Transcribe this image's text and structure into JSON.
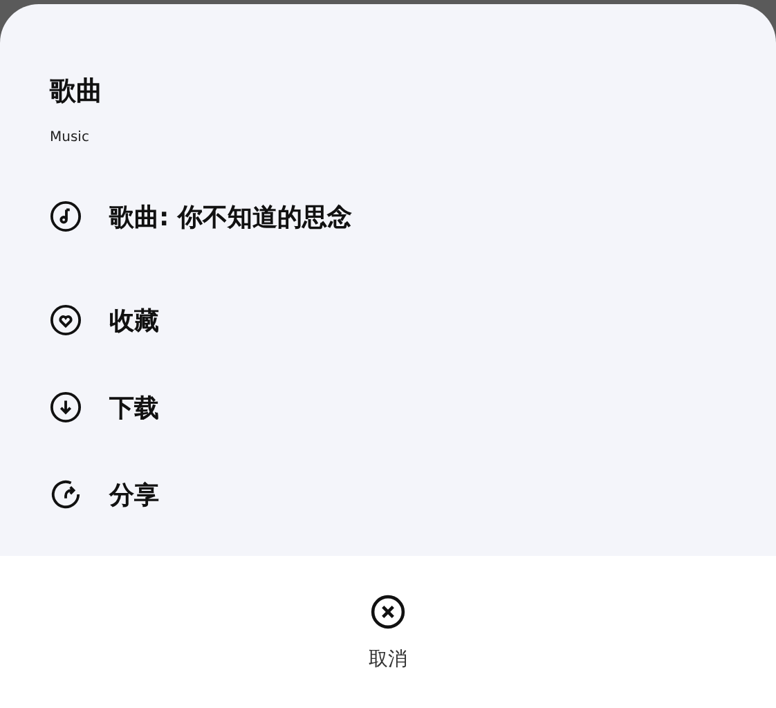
{
  "sheet": {
    "title": "歌曲",
    "subtitle": "Music"
  },
  "actions": [
    {
      "label": "歌曲: 你不知道的思念"
    },
    {
      "label": "收藏"
    },
    {
      "label": "下载"
    },
    {
      "label": "分享"
    }
  ],
  "cancel": {
    "label": "取消"
  }
}
